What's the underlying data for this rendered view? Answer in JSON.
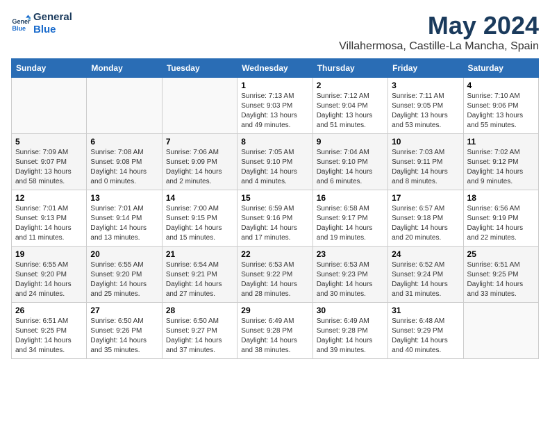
{
  "header": {
    "logo_line1": "General",
    "logo_line2": "Blue",
    "month": "May 2024",
    "location": "Villahermosa, Castille-La Mancha, Spain"
  },
  "weekdays": [
    "Sunday",
    "Monday",
    "Tuesday",
    "Wednesday",
    "Thursday",
    "Friday",
    "Saturday"
  ],
  "weeks": [
    [
      {
        "day": "",
        "info": ""
      },
      {
        "day": "",
        "info": ""
      },
      {
        "day": "",
        "info": ""
      },
      {
        "day": "1",
        "info": "Sunrise: 7:13 AM\nSunset: 9:03 PM\nDaylight: 13 hours and 49 minutes."
      },
      {
        "day": "2",
        "info": "Sunrise: 7:12 AM\nSunset: 9:04 PM\nDaylight: 13 hours and 51 minutes."
      },
      {
        "day": "3",
        "info": "Sunrise: 7:11 AM\nSunset: 9:05 PM\nDaylight: 13 hours and 53 minutes."
      },
      {
        "day": "4",
        "info": "Sunrise: 7:10 AM\nSunset: 9:06 PM\nDaylight: 13 hours and 55 minutes."
      }
    ],
    [
      {
        "day": "5",
        "info": "Sunrise: 7:09 AM\nSunset: 9:07 PM\nDaylight: 13 hours and 58 minutes."
      },
      {
        "day": "6",
        "info": "Sunrise: 7:08 AM\nSunset: 9:08 PM\nDaylight: 14 hours and 0 minutes."
      },
      {
        "day": "7",
        "info": "Sunrise: 7:06 AM\nSunset: 9:09 PM\nDaylight: 14 hours and 2 minutes."
      },
      {
        "day": "8",
        "info": "Sunrise: 7:05 AM\nSunset: 9:10 PM\nDaylight: 14 hours and 4 minutes."
      },
      {
        "day": "9",
        "info": "Sunrise: 7:04 AM\nSunset: 9:10 PM\nDaylight: 14 hours and 6 minutes."
      },
      {
        "day": "10",
        "info": "Sunrise: 7:03 AM\nSunset: 9:11 PM\nDaylight: 14 hours and 8 minutes."
      },
      {
        "day": "11",
        "info": "Sunrise: 7:02 AM\nSunset: 9:12 PM\nDaylight: 14 hours and 9 minutes."
      }
    ],
    [
      {
        "day": "12",
        "info": "Sunrise: 7:01 AM\nSunset: 9:13 PM\nDaylight: 14 hours and 11 minutes."
      },
      {
        "day": "13",
        "info": "Sunrise: 7:01 AM\nSunset: 9:14 PM\nDaylight: 14 hours and 13 minutes."
      },
      {
        "day": "14",
        "info": "Sunrise: 7:00 AM\nSunset: 9:15 PM\nDaylight: 14 hours and 15 minutes."
      },
      {
        "day": "15",
        "info": "Sunrise: 6:59 AM\nSunset: 9:16 PM\nDaylight: 14 hours and 17 minutes."
      },
      {
        "day": "16",
        "info": "Sunrise: 6:58 AM\nSunset: 9:17 PM\nDaylight: 14 hours and 19 minutes."
      },
      {
        "day": "17",
        "info": "Sunrise: 6:57 AM\nSunset: 9:18 PM\nDaylight: 14 hours and 20 minutes."
      },
      {
        "day": "18",
        "info": "Sunrise: 6:56 AM\nSunset: 9:19 PM\nDaylight: 14 hours and 22 minutes."
      }
    ],
    [
      {
        "day": "19",
        "info": "Sunrise: 6:55 AM\nSunset: 9:20 PM\nDaylight: 14 hours and 24 minutes."
      },
      {
        "day": "20",
        "info": "Sunrise: 6:55 AM\nSunset: 9:20 PM\nDaylight: 14 hours and 25 minutes."
      },
      {
        "day": "21",
        "info": "Sunrise: 6:54 AM\nSunset: 9:21 PM\nDaylight: 14 hours and 27 minutes."
      },
      {
        "day": "22",
        "info": "Sunrise: 6:53 AM\nSunset: 9:22 PM\nDaylight: 14 hours and 28 minutes."
      },
      {
        "day": "23",
        "info": "Sunrise: 6:53 AM\nSunset: 9:23 PM\nDaylight: 14 hours and 30 minutes."
      },
      {
        "day": "24",
        "info": "Sunrise: 6:52 AM\nSunset: 9:24 PM\nDaylight: 14 hours and 31 minutes."
      },
      {
        "day": "25",
        "info": "Sunrise: 6:51 AM\nSunset: 9:25 PM\nDaylight: 14 hours and 33 minutes."
      }
    ],
    [
      {
        "day": "26",
        "info": "Sunrise: 6:51 AM\nSunset: 9:25 PM\nDaylight: 14 hours and 34 minutes."
      },
      {
        "day": "27",
        "info": "Sunrise: 6:50 AM\nSunset: 9:26 PM\nDaylight: 14 hours and 35 minutes."
      },
      {
        "day": "28",
        "info": "Sunrise: 6:50 AM\nSunset: 9:27 PM\nDaylight: 14 hours and 37 minutes."
      },
      {
        "day": "29",
        "info": "Sunrise: 6:49 AM\nSunset: 9:28 PM\nDaylight: 14 hours and 38 minutes."
      },
      {
        "day": "30",
        "info": "Sunrise: 6:49 AM\nSunset: 9:28 PM\nDaylight: 14 hours and 39 minutes."
      },
      {
        "day": "31",
        "info": "Sunrise: 6:48 AM\nSunset: 9:29 PM\nDaylight: 14 hours and 40 minutes."
      },
      {
        "day": "",
        "info": ""
      }
    ]
  ]
}
